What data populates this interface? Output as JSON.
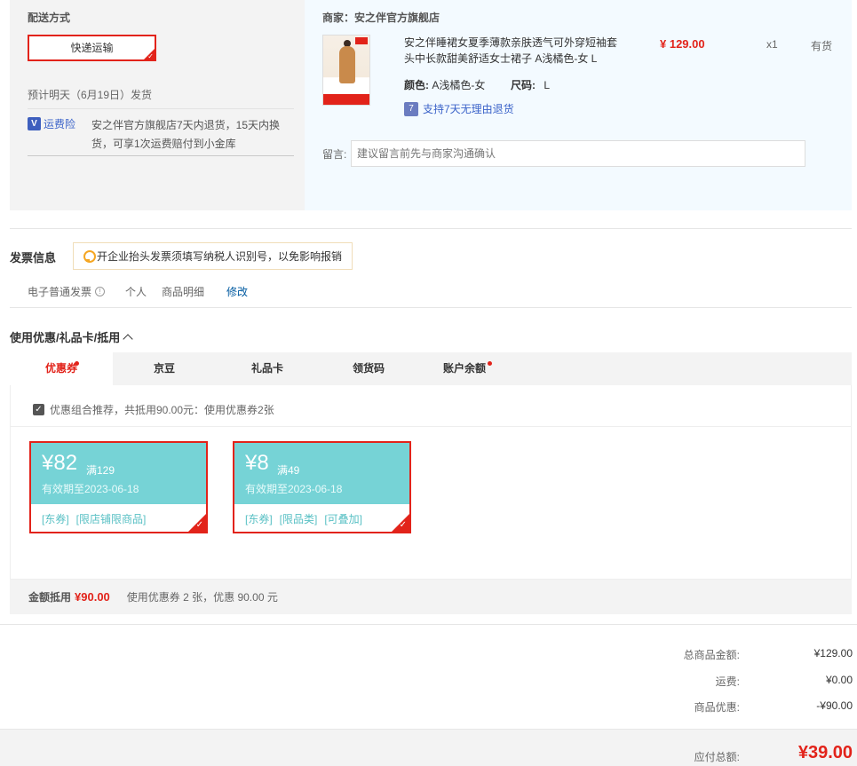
{
  "shipping": {
    "title": "配送方式",
    "method": "快递运输",
    "eta": "预计明天（6月19日）发货",
    "insurance_badge": "运费险",
    "insurance_text": "安之伴官方旗舰店7天内退货，15天内换货，可享1次运费赔付到小金库"
  },
  "order": {
    "merchant": "商家：安之伴官方旗舰店",
    "product_title": "安之伴睡裙女夏季薄款亲肤透气可外穿短袖套头中长款甜美舒适女士裙子 A浅橘色-女 L",
    "price": "¥ 129.00",
    "qty": "x1",
    "stock": "有货",
    "color_label": "颜色:",
    "color_value": "A浅橘色-女",
    "size_label": "尺码:",
    "size_value": "L",
    "return_policy": "支持7天无理由退货",
    "note_label": "留言:",
    "note_placeholder": "建议留言前先与商家沟通确认"
  },
  "invoice": {
    "title": "发票信息",
    "tip": "开企业抬头发票须填写纳税人识别号，以免影响报销",
    "type": "电子普通发票",
    "person": "个人",
    "detail": "商品明细",
    "edit": "修改"
  },
  "coupons": {
    "title": "使用优惠/礼品卡/抵用",
    "tabs": [
      {
        "label": "优惠券"
      },
      {
        "label": "京豆"
      },
      {
        "label": "礼品卡"
      },
      {
        "label": "领货码"
      },
      {
        "label": "账户余额"
      }
    ],
    "combo_text": "优惠组合推荐，共抵用90.00元：使用优惠券2张",
    "items": [
      {
        "amount": "¥82",
        "condition": "满129",
        "expiry": "有效期至2023-06-18",
        "tags": [
          "[东券]",
          "[限店铺限商品]"
        ]
      },
      {
        "amount": "¥8",
        "condition": "满49",
        "expiry": "有效期至2023-06-18",
        "tags": [
          "[东券]",
          "[限品类]",
          "[可叠加]"
        ]
      }
    ],
    "summary_label": "金额抵用",
    "summary_value": "¥90.00",
    "summary_desc": "使用优惠券 2 张，优惠 90.00 元"
  },
  "totals": {
    "subtotal_label": "总商品金额:",
    "subtotal": "¥129.00",
    "shipping_label": "运费:",
    "shipping": "¥0.00",
    "discount_label": "商品优惠:",
    "discount": "-¥90.00",
    "payable_label": "应付总额:",
    "payable": "¥39.00"
  },
  "colors": {
    "accent": "#e2231a",
    "coupon": "#76d3d6",
    "link": "#005aa0"
  }
}
